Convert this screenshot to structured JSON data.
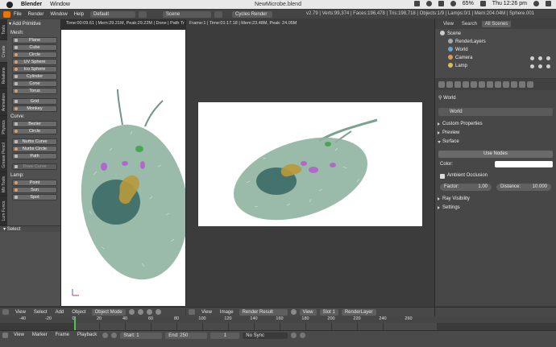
{
  "mac": {
    "menu": [
      "Blender",
      "Window"
    ],
    "title": "NewMicrobe.blend",
    "battery": "65%",
    "clock": "Thu 12:26 pm"
  },
  "topbar": {
    "menus": [
      "File",
      "Render",
      "Window",
      "Help"
    ],
    "layout": "Default",
    "scene": "Scene",
    "engine": "Cycles Render",
    "stats": "v2.79 | Verts:99,374 | Faces:196,478 | Tris:198,718 | Objects:1/9 | Lamps:0/1 | Mem:204.04M | Sphere.001"
  },
  "tool_tabs": [
    "Tools",
    "Create",
    "Relations",
    "Animation",
    "Physics",
    "Grease Pencil",
    "Mb Tools",
    "Lum Funcs"
  ],
  "shelf": {
    "header": "Add Primitive",
    "mesh_label": "Mesh:",
    "mesh": [
      "Plane",
      "Cube",
      "Circle",
      "UV Sphere",
      "Ico Sphere",
      "Cylinder",
      "Cone",
      "Torus"
    ],
    "mesh_extra": [
      "Grid",
      "Monkey"
    ],
    "curve_label": "Curve:",
    "curve": [
      "Bezier",
      "Circle",
      "Nurbs Curve",
      "Nurbs Circle",
      "Path"
    ],
    "draw_curve": "Draw Curve",
    "lamp_label": "Lamp:",
    "lamp": [
      "Point",
      "Sun",
      "Spot"
    ],
    "select": "Select"
  },
  "viewport": {
    "status": "Time:00:09.61 | Mem:29.21M, Peak:29.22M | Done | Path Tr"
  },
  "image_editor": {
    "status": "Frame:1 | Time:01:17.18 | Mem:23.48M, Peak: 24.05M"
  },
  "view3d_header": {
    "menus": [
      "View",
      "Select",
      "Add",
      "Object"
    ],
    "mode": "Object Mode"
  },
  "image_header": {
    "menus": [
      "View",
      "Image"
    ],
    "image": "Render Result",
    "view": "View",
    "slot": "Slot 1",
    "layer": "RenderLayer"
  },
  "timeline": {
    "ticks": [
      "-40",
      "-20",
      "0",
      "20",
      "40",
      "60",
      "80",
      "100",
      "120",
      "140",
      "160",
      "180",
      "200",
      "220",
      "240",
      "260"
    ],
    "current_frame": "1",
    "menus": [
      "View",
      "Marker",
      "Frame",
      "Playback"
    ],
    "start_label": "Start:",
    "start": "1",
    "end_label": "End:",
    "end": "250",
    "frame": "1",
    "sync": "No Sync"
  },
  "outliner": {
    "view": "View",
    "search": "Search",
    "filter": "All Scenes",
    "items": [
      "Scene",
      "RenderLayers",
      "World",
      "Camera",
      "Lamp"
    ]
  },
  "properties": {
    "breadcrumb": "World",
    "world_field": "World",
    "sections": {
      "custom": "Custom Properties",
      "preview": "Preview",
      "surface": "Surface",
      "use_nodes": "Use Nodes",
      "color": "Color:",
      "ao": "Ambient Occlusion",
      "factor_label": "Factor:",
      "factor": "1.00",
      "distance_label": "Distance:",
      "distance": "10.000",
      "ray": "Ray Visibility",
      "settings": "Settings"
    }
  },
  "colors": {
    "orange": "#ea7600",
    "microbe_body": "#8fb3a1",
    "nucleus": "#3f6f6a",
    "purple": "#b069c8",
    "green": "#49a652",
    "gold": "#b89a3a"
  }
}
